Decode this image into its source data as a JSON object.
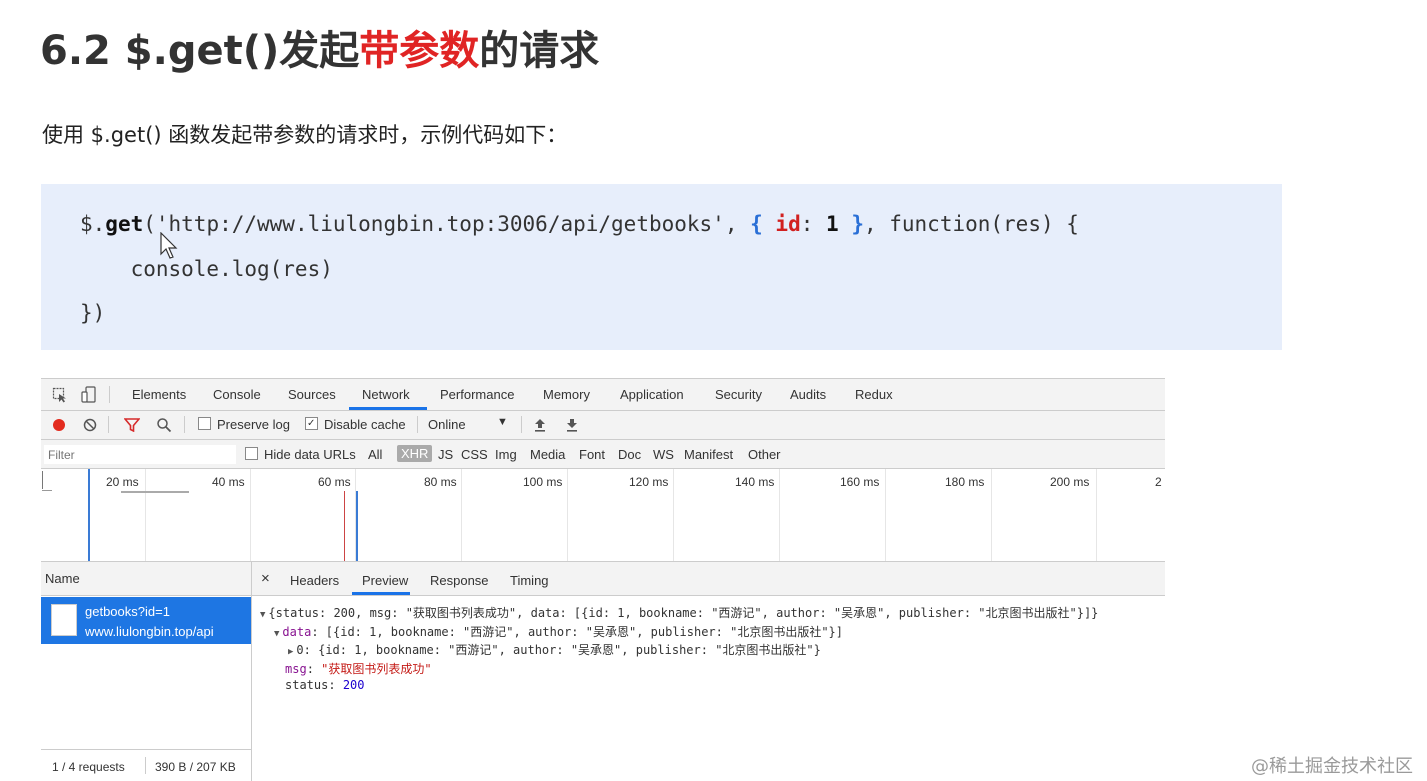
{
  "slide": {
    "title_prefix": "6.2 $.get()发起",
    "title_highlight": "带参数",
    "title_suffix": "的请求",
    "intro": "使用 $.get() 函数发起带参数的请求时，示例代码如下："
  },
  "code": {
    "line1_a": "$.",
    "line1_get": "get",
    "line1_b": "('http://www.liulongbin.top:3006/api/getbooks', ",
    "line1_open": "{",
    "line1_key": "id",
    "line1_colon": ": ",
    "line1_val": "1",
    "line1_close": " }",
    "line1_c": ", function(res) {",
    "line2": "    console.log(res)",
    "line3": "})"
  },
  "devtools": {
    "tabs": [
      "Elements",
      "Console",
      "Sources",
      "Network",
      "Performance",
      "Memory",
      "Application",
      "Security",
      "Audits",
      "Redux"
    ],
    "toolbar": {
      "preserve_log": "Preserve log",
      "disable_cache": "Disable cache",
      "throttle": "Online"
    },
    "filter": {
      "placeholder": "Filter",
      "hide_data_urls": "Hide data URLs",
      "types": [
        "All",
        "XHR",
        "JS",
        "CSS",
        "Img",
        "Media",
        "Font",
        "Doc",
        "WS",
        "Manifest",
        "Other"
      ]
    },
    "timeline_ticks": [
      "20 ms",
      "40 ms",
      "60 ms",
      "80 ms",
      "100 ms",
      "120 ms",
      "140 ms",
      "160 ms",
      "180 ms",
      "200 ms",
      "2"
    ],
    "name_header": "Name",
    "request": {
      "name": "getbooks?id=1",
      "domain": "www.liulongbin.top/api"
    },
    "status_requests": "1 / 4 requests",
    "status_size": "390 B / 207 KB",
    "detail_tabs": [
      "Headers",
      "Preview",
      "Response",
      "Timing"
    ],
    "preview": {
      "line1": "{status: 200, msg: \"获取图书列表成功\", data: [{id: 1, bookname: \"西游记\", author: \"吴承恩\", publisher: \"北京图书出版社\"}]}",
      "line2_key": "data",
      "line2_val": ": [{id: 1, bookname: \"西游记\", author: \"吴承恩\", publisher: \"北京图书出版社\"}]",
      "line3": "0: {id: 1, bookname: \"西游记\", author: \"吴承恩\", publisher: \"北京图书出版社\"}",
      "line4_key": "msg",
      "line4_val": "\"获取图书列表成功\"",
      "line5_key": "status",
      "line5_val": "200"
    }
  },
  "watermark": "@稀土掘金技术社区"
}
